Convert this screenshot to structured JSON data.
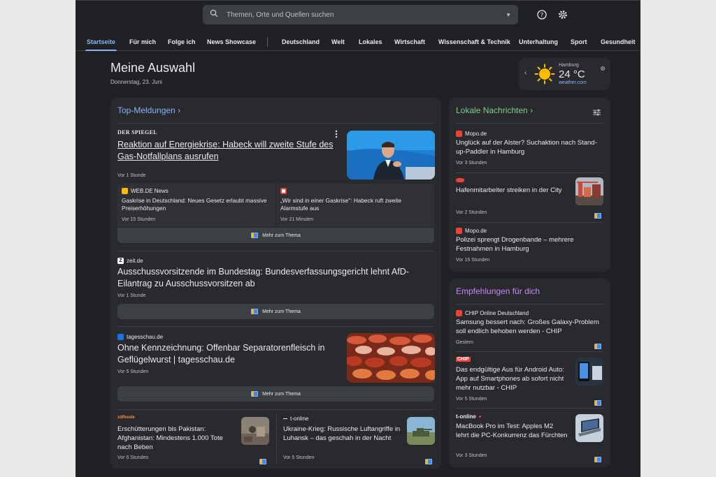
{
  "search": {
    "placeholder": "Themen, Orte und Quellen suchen"
  },
  "nav": {
    "tabs": [
      {
        "label": "Startseite",
        "active": true
      },
      {
        "label": "Für mich"
      },
      {
        "label": "Folge ich"
      },
      {
        "label": "News Showcase"
      },
      {
        "label": "Deutschland"
      },
      {
        "label": "Welt"
      },
      {
        "label": "Lokales"
      },
      {
        "label": "Wirtschaft"
      },
      {
        "label": "Wissenschaft & Technik"
      },
      {
        "label": "Unterhaltung"
      },
      {
        "label": "Sport"
      },
      {
        "label": "Gesundheit"
      }
    ]
  },
  "header": {
    "title": "Meine Auswahl",
    "date": "Donnerstag, 23. Juni"
  },
  "weather": {
    "city": "Hamburg",
    "temp": "24 °C",
    "source": "weather.com"
  },
  "top": {
    "heading": "Top-Meldungen",
    "lead": {
      "source": "DER SPIEGEL",
      "title": "Reaktion auf Energiekrise: Habeck will zweite Stufe des Gas-Notfallplans ausrufen",
      "time": "Vor 1 Stunde"
    },
    "related": [
      {
        "source": "WEB.DE News",
        "title": "Gaskrise in Deutschland: Neues Gesetz erlaubt massive Preiserhöhungen",
        "time": "Vor 15 Stunden"
      },
      {
        "source": "",
        "title": "„Wir sind in einer Gaskrise\": Habeck ruft zweite Alarmstufe aus",
        "time": "Vor 21 Minuten"
      }
    ],
    "more_label": "Mehr zum Thema",
    "story2": {
      "source": "zeit.de",
      "title": "Ausschussvorsitzende im Bundestag: Bundesverfassungsgericht lehnt AfD-Eilantrag zu Ausschussvorsitzen ab",
      "time": "Vor 1 Stunde"
    },
    "story3": {
      "source": "tagesschau.de",
      "title": "Ohne Kennzeichnung: Offenbar Separatorenfleisch in Geflügelwurst | tagesschau.de",
      "time": "Vor 5 Stunden"
    },
    "bottom": [
      {
        "source": "zdfheute",
        "title": "Erschütterungen bis Pakistan: Afghanistan: Mindestens 1.000 Tote nach Beben",
        "time": "Vor 6 Stunden"
      },
      {
        "source": "t-online",
        "title": "Ukraine-Krieg: Russische Luftangriffe in Luhansk – das geschah in der Nacht",
        "time": "Vor 5 Stunden"
      }
    ]
  },
  "local": {
    "heading": "Lokale Nachrichten",
    "items": [
      {
        "source": "Mopo.de",
        "title": "Unglück auf der Alster? Suchaktion nach Stand-up-Paddler in Hamburg",
        "time": "Vor 3 Stunden"
      },
      {
        "source": "",
        "title": "Hafenmitarbeiter streiken in der City",
        "time": "Vor 2 Stunden"
      },
      {
        "source": "Mopo.de",
        "title": "Polizei sprengt Drogenbande – mehrere Festnahmen in Hamburg",
        "time": "Vor 15 Stunden"
      }
    ]
  },
  "recs": {
    "heading": "Empfehlungen für dich",
    "items": [
      {
        "source": "CHIP Online Deutschland",
        "title": "Samsung bessert nach: Großes Galaxy-Problem soll endlich behoben werden - CHIP",
        "time": "Gestern"
      },
      {
        "source": "CHIP",
        "title": "Das endgültige Aus für Android Auto: App auf Smartphones ab sofort nicht mehr nutzbar - CHIP",
        "time": "Vor 5 Stunden"
      },
      {
        "source": "t-online",
        "title": "MacBook Pro im Test: Apples M2 lehrt die PC-Konkurrenz das Fürchten",
        "time": "Vor 3 Stunden"
      }
    ]
  },
  "colors": {
    "accent": "#8ab4f8",
    "background": "#202124",
    "card": "#292a2d"
  }
}
